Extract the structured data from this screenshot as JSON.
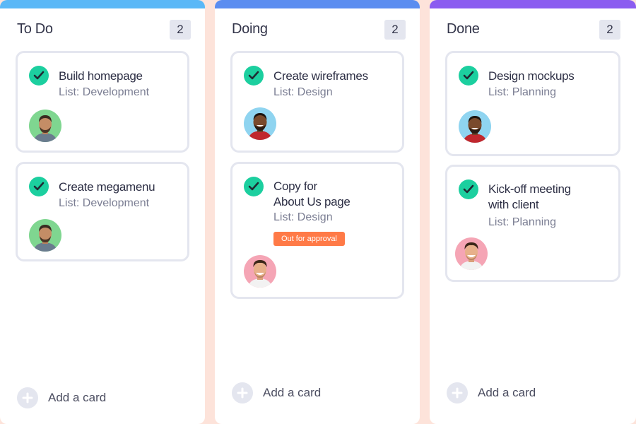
{
  "board": {
    "columns": [
      {
        "title": "To Do",
        "count": "2",
        "accent": "#5ab8f7",
        "cards": [
          {
            "title": "Build homepage",
            "list": "List: Development"
          },
          {
            "title": "Create megamenu",
            "list": "List: Development"
          }
        ],
        "add_label": "Add a card"
      },
      {
        "title": "Doing",
        "count": "2",
        "accent": "#5b8df0",
        "cards": [
          {
            "title": "Create wireframes",
            "list": "List: Design"
          },
          {
            "title_line1": "Copy for",
            "title_line2": "About Us page",
            "list": "List: Design",
            "tag": "Out for approval"
          }
        ],
        "add_label": "Add a card"
      },
      {
        "title": "Done",
        "count": "2",
        "accent": "#8b5cf0",
        "cards": [
          {
            "title": "Design mockups",
            "list": "List: Planning"
          },
          {
            "title_line1": "Kick-off meeting",
            "title_line2": "with client",
            "list": "List: Planning"
          }
        ],
        "add_label": "Add a card"
      }
    ]
  },
  "colors": {
    "check": "#1ccf9f",
    "tag": "#ff7a47",
    "background": "#fde3da"
  },
  "icons": {
    "card_check": "check-circle-icon",
    "add": "plus-circle-icon",
    "assignee": "avatar"
  }
}
